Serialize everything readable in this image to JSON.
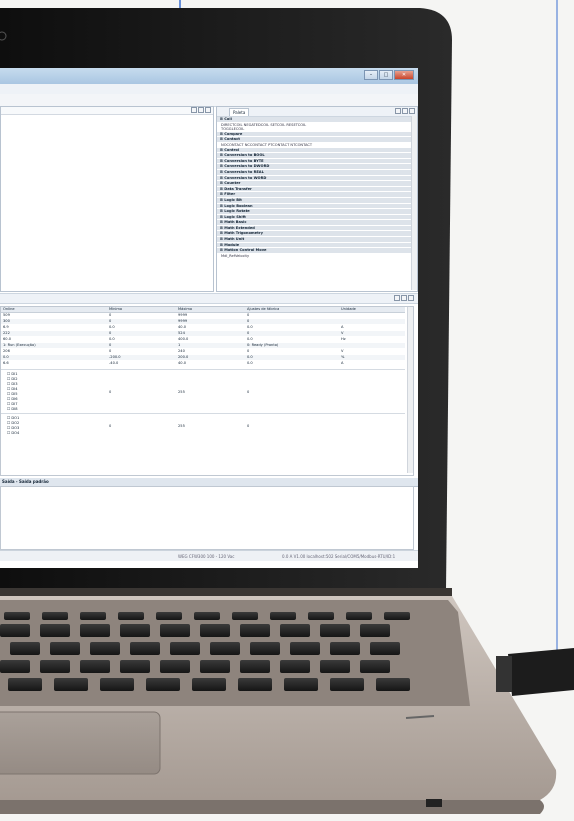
{
  "palette": {
    "tab": "Paleta",
    "items": [
      {
        "kind": "cat",
        "label": "Coil"
      },
      {
        "kind": "sub",
        "label": "DIRECTCOIL    NEGATEDCOIL    SETCOIL    RESETCOIL"
      },
      {
        "kind": "sub",
        "label": "TOGGLECOIL"
      },
      {
        "kind": "cat",
        "label": "Compare"
      },
      {
        "kind": "cat",
        "label": "Contact"
      },
      {
        "kind": "sub",
        "label": "NOCONTACT    NCCONTACT    PTCONTACT    NTCONTACT"
      },
      {
        "kind": "cat",
        "label": "Control"
      },
      {
        "kind": "cat",
        "label": "Conversion to BOOL"
      },
      {
        "kind": "cat",
        "label": "Conversion to BYTE"
      },
      {
        "kind": "cat",
        "label": "Conversion to DWORD"
      },
      {
        "kind": "cat",
        "label": "Conversion to REAL"
      },
      {
        "kind": "cat",
        "label": "Conversion to WORD"
      },
      {
        "kind": "cat",
        "label": "Counter"
      },
      {
        "kind": "cat",
        "label": "Data Transfer"
      },
      {
        "kind": "cat",
        "label": "Filter"
      },
      {
        "kind": "cat",
        "label": "Logic Bit"
      },
      {
        "kind": "cat",
        "label": "Logic Boolean"
      },
      {
        "kind": "cat",
        "label": "Logic Rotate"
      },
      {
        "kind": "cat",
        "label": "Logic Shift"
      },
      {
        "kind": "cat",
        "label": "Math Basic"
      },
      {
        "kind": "cat",
        "label": "Math Extended"
      },
      {
        "kind": "cat",
        "label": "Math Trigonometry"
      },
      {
        "kind": "cat",
        "label": "Math Unit"
      },
      {
        "kind": "cat",
        "label": "Module"
      },
      {
        "kind": "cat",
        "label": "Motion Control Move"
      },
      {
        "kind": "sub",
        "label": "Mdl_RefVelocity"
      }
    ]
  },
  "table": {
    "headers": [
      "Online",
      "Mínimo",
      "Máximo",
      "Ajustes de fábrica",
      "Unidade"
    ],
    "rows": [
      [
        "509",
        "0",
        "9999",
        "0",
        ""
      ],
      [
        "300",
        "0",
        "9999",
        "0",
        ""
      ],
      [
        "6.9",
        "0.0",
        "40.0",
        "0.0",
        "A"
      ],
      [
        "222",
        "0",
        "524",
        "0",
        "V"
      ],
      [
        "60.0",
        "0.0",
        "400.0",
        "0.0",
        "Hz"
      ],
      [
        "1: Run (Execução)",
        "0",
        "1",
        "0: Ready (Pronto)",
        ""
      ],
      [
        "206",
        "0",
        "240",
        "0",
        "V"
      ],
      [
        "0.0",
        "-200.0",
        "200.0",
        "0.0",
        "%"
      ],
      [
        "6.6",
        "-40.0",
        "40.0",
        "0.0",
        "A"
      ]
    ],
    "group1": {
      "items": [
        "DI1",
        "DI2",
        "DI3",
        "DI4",
        "DI5",
        "DI6",
        "DI7",
        "DI8"
      ],
      "min": "0",
      "max": "255",
      "factory": "0"
    },
    "group2": {
      "items": [
        "DO1",
        "DO2",
        "DO3",
        "DO4"
      ],
      "min": "0",
      "max": "255",
      "factory": "0"
    }
  },
  "output": {
    "tab": "Saída - Saída padrão"
  },
  "status": {
    "device": "WEG CFW300 100 - 120 Vac",
    "connection": "0.0 A V1.00 localhost:502 Serial/COM5/Modbus-RTU/ID:1"
  },
  "colors": {
    "screen_accent": "#a9c6e2",
    "close_button": "#c9452c",
    "laptop_body": "#b7aca4"
  }
}
